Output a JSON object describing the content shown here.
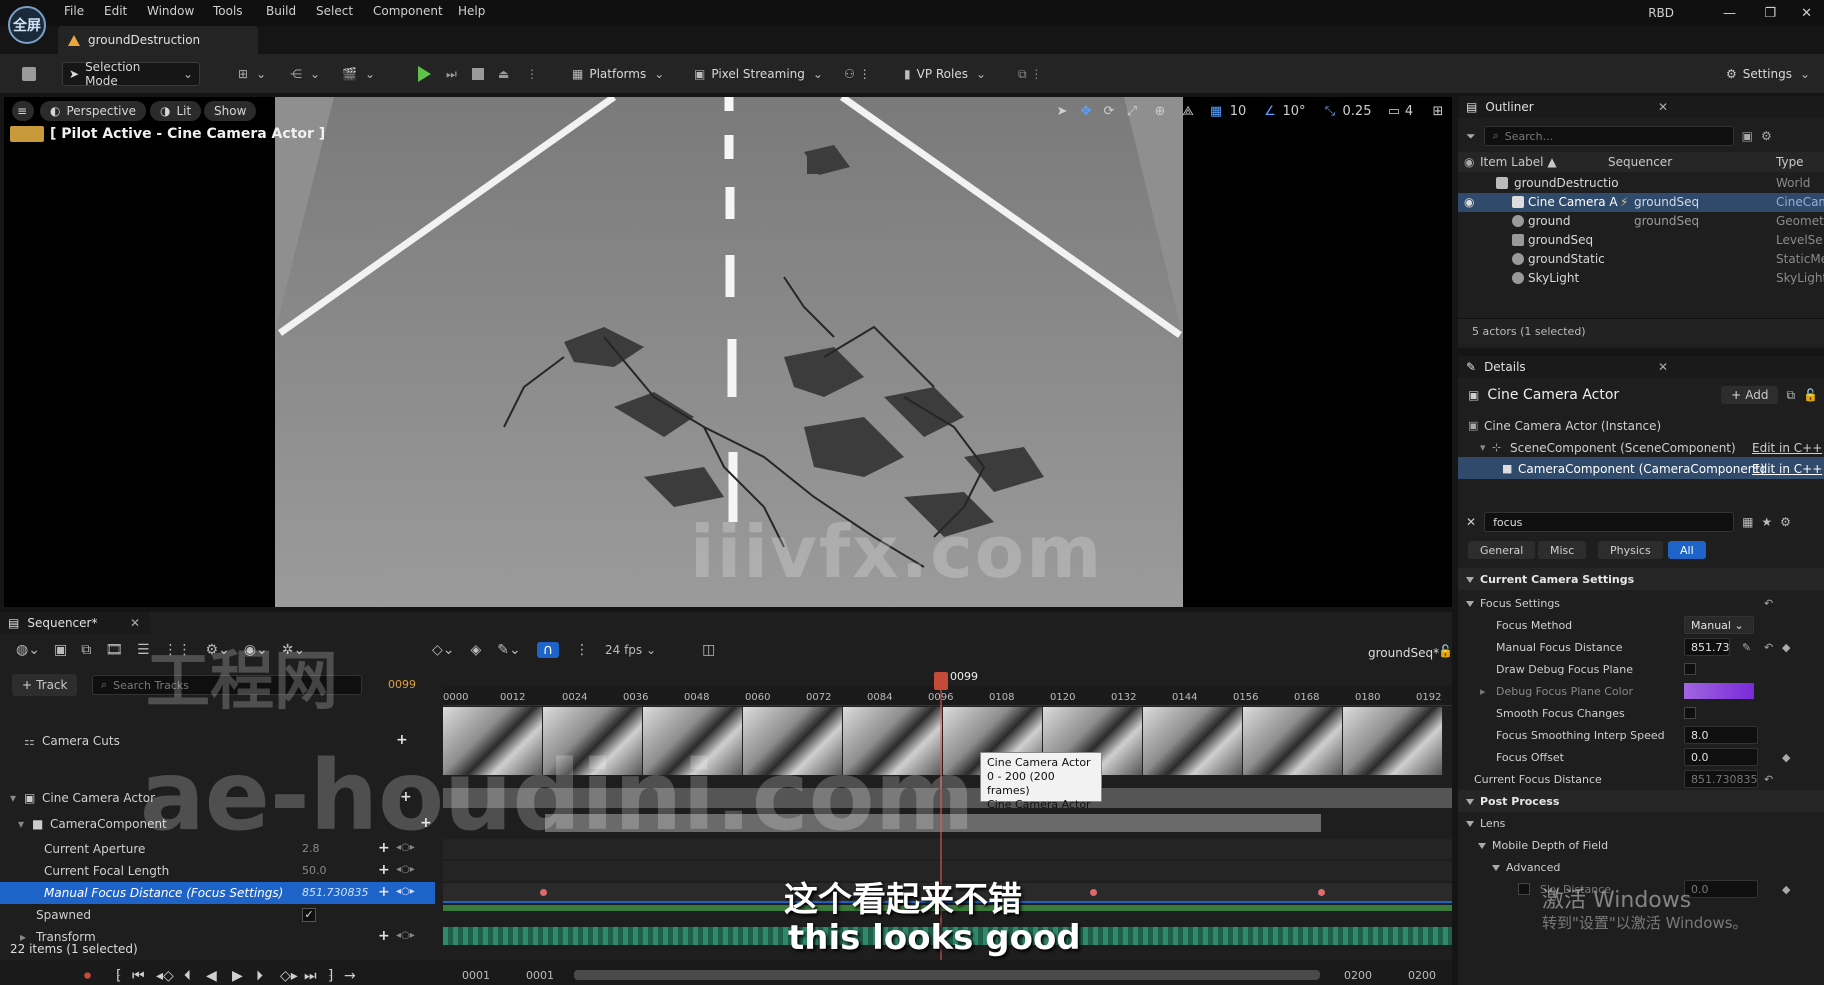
{
  "menu": [
    "File",
    "Edit",
    "Window",
    "Tools",
    "Build",
    "Select",
    "Component",
    "Help"
  ],
  "logo_text": "全屏",
  "document_tab": "groundDestruction",
  "window_user": "RBD",
  "toolbar": {
    "selection_mode": "Selection Mode",
    "platforms": "Platforms",
    "pixel_streaming": "Pixel Streaming",
    "vp_roles": "VP Roles",
    "settings": "Settings"
  },
  "viewport": {
    "perspective": "Perspective",
    "lit": "Lit",
    "show": "Show",
    "pilot_label": "[ Pilot Active - Cine Camera Actor ]",
    "grid_snap": "10",
    "angle_snap": "10°",
    "scale_snap": "0.25",
    "camera_speed": "4",
    "watermark": "iiivfx.com"
  },
  "outliner": {
    "tab": "Outliner",
    "search_placeholder": "Search...",
    "col_label": "Item Label ▲",
    "col_seq": "Sequencer",
    "col_type": "Type",
    "rows": [
      {
        "label": "groundDestructio",
        "seq": "",
        "type": "World"
      },
      {
        "label": "Cine Camera A",
        "seq": "groundSeq",
        "type": "CineCam"
      },
      {
        "label": "ground",
        "seq": "groundSeq",
        "type": "Geometr"
      },
      {
        "label": "groundSeq",
        "seq": "",
        "type": "LevelSe"
      },
      {
        "label": "groundStatic",
        "seq": "",
        "type": "StaticMe"
      },
      {
        "label": "SkyLight",
        "seq": "",
        "type": "SkyLight"
      }
    ],
    "status": "5 actors (1 selected)"
  },
  "details": {
    "tab": "Details",
    "actor_name": "Cine Camera Actor",
    "add_label": "Add",
    "components": [
      {
        "label": "Cine Camera Actor (Instance)",
        "edit": ""
      },
      {
        "label": "SceneComponent (SceneComponent)",
        "edit": "Edit in C++"
      },
      {
        "label": "CameraComponent (CameraComponent)",
        "edit": "Edit in C++"
      }
    ],
    "filter_text": "focus",
    "filters": [
      "General",
      "Misc",
      "Physics",
      "All"
    ],
    "sections": {
      "current_camera_settings": "Current Camera Settings",
      "focus_settings": "Focus Settings",
      "post_process": "Post Process",
      "lens": "Lens"
    },
    "props": {
      "focus_method": {
        "label": "Focus Method",
        "value": "Manual"
      },
      "manual_focus_distance": {
        "label": "Manual Focus Distance",
        "value": "851.73"
      },
      "draw_debug_focus_plane": {
        "label": "Draw Debug Focus Plane"
      },
      "debug_focus_plane_color": {
        "label": "Debug Focus Plane Color"
      },
      "smooth_focus_changes": {
        "label": "Smooth Focus Changes"
      },
      "focus_smoothing_interp_speed": {
        "label": "Focus Smoothing Interp Speed",
        "value": "8.0"
      },
      "focus_offset": {
        "label": "Focus Offset",
        "value": "0.0"
      },
      "current_focus_distance": {
        "label": "Current Focus Distance",
        "value": "851.730835"
      },
      "mobile_depth_of_field": {
        "label": "Mobile Depth of Field"
      },
      "advanced": {
        "label": "Advanced"
      },
      "sky_distance": {
        "label": "Sky Distance",
        "value": "0.0"
      }
    },
    "watermark_line1": "激活 Windows",
    "watermark_line2": "转到\"设置\"以激活 Windows。"
  },
  "sequencer": {
    "tab": "Sequencer*",
    "fps": "24 fps",
    "seq_name": "groundSeq*",
    "track_button": "Track",
    "search_placeholder": "Search Tracks",
    "current_frame": "0099",
    "playhead_label": "0099",
    "ticks": [
      "0000",
      "0012",
      "0024",
      "0036",
      "0048",
      "0060",
      "0072",
      "0084",
      "0096",
      "0108",
      "0120",
      "0132",
      "0144",
      "0156",
      "0168",
      "0180",
      "0192"
    ],
    "rows": [
      {
        "label": "Camera Cuts",
        "value": ""
      },
      {
        "label": "Cine Camera Actor",
        "value": ""
      },
      {
        "label": "CameraComponent",
        "value": ""
      },
      {
        "label": "Current Aperture",
        "value": "2.8"
      },
      {
        "label": "Current Focal Length",
        "value": "50.0"
      },
      {
        "label": "Manual Focus Distance (Focus Settings)",
        "value": "851.730835"
      },
      {
        "label": "Spawned",
        "value": ""
      },
      {
        "label": "Transform",
        "value": ""
      }
    ],
    "status": "22 items (1 selected)",
    "tooltip": [
      "Cine Camera Actor",
      "0 - 200 (200 frames)",
      "Cine Camera Actor"
    ],
    "range_start": "0001",
    "range_start2": "0001",
    "range_end": "0200",
    "range_end2": "0200",
    "watermark_cn": "工程网",
    "watermark_en": "ae-houdini.com"
  },
  "subtitles": {
    "cn": "这个看起来不错",
    "en": "this looks good"
  },
  "colors": {
    "accent": "#1e64c8",
    "selection": "#2f4a6a",
    "play_green": "#5fc24a",
    "keyframe": "#e06a6a"
  }
}
